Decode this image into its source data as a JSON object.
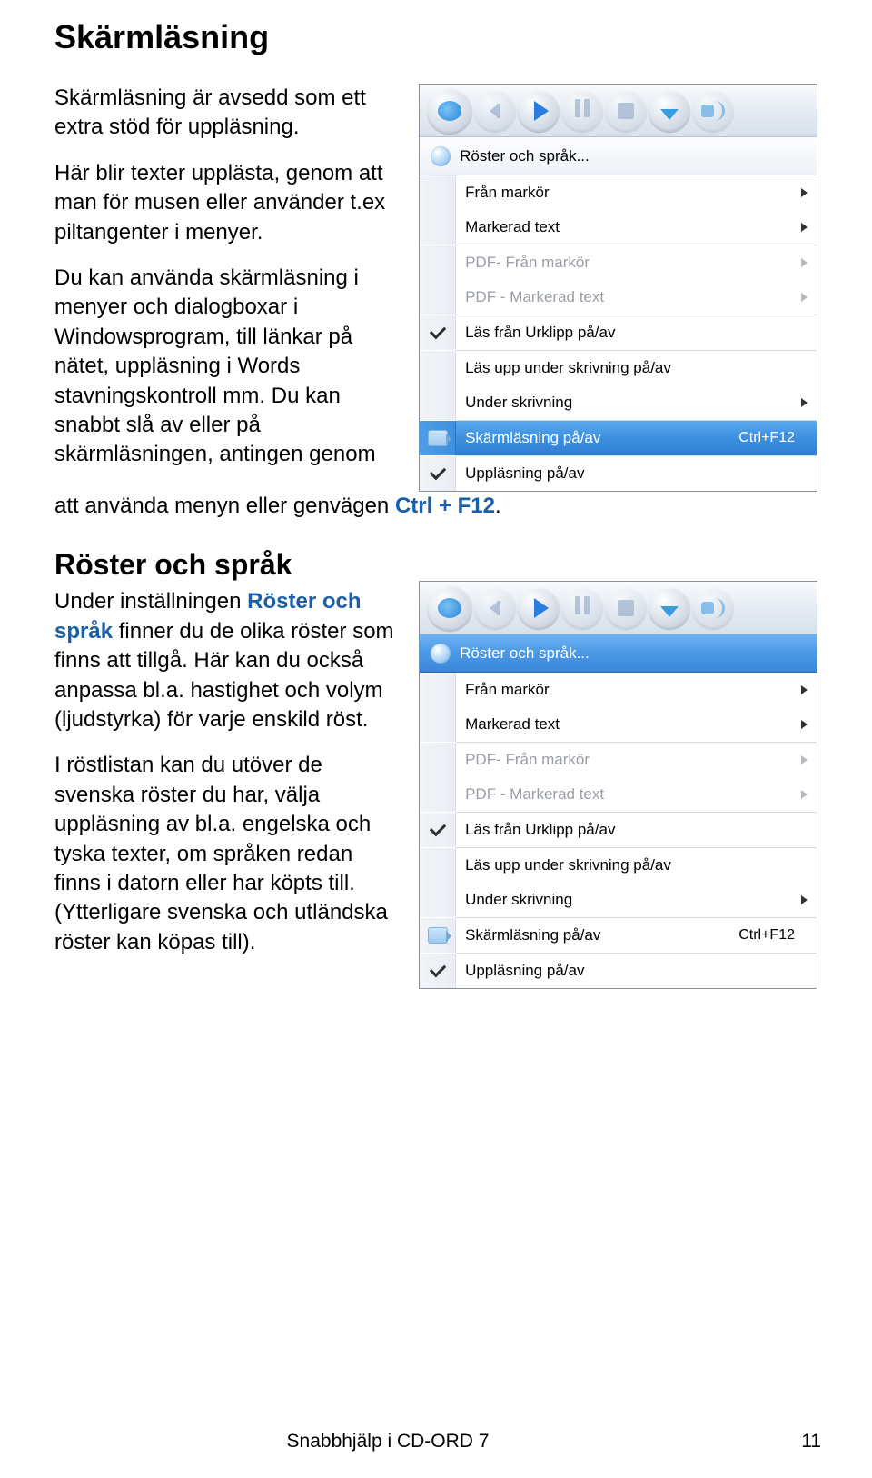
{
  "page_title": "Skärmläsning",
  "intro_p1": "Skärmläsning är avsedd som ett extra stöd för uppläsning.",
  "intro_p2": "Här blir texter upplästa, genom att man för musen eller använder t.ex piltangenter i menyer.",
  "intro_p3a": "Du kan använda skärmläsning i menyer och dialogboxar i Windowsprogram, till länkar på nätet, uppläsning i Words stavningskontroll mm. Du kan snabbt slå av eller på skärmläsningen, antingen genom ",
  "intro_p3b": "att använda menyn eller genvägen ",
  "shortcut_bold": "Ctrl + F12",
  "period": ".",
  "section2_title": "Röster och språk",
  "section2_p1_a": "Under inställningen ",
  "section2_p1_bold": "Röster och språk",
  "section2_p1_b": " finner du de olika röster som finns att tillgå. Här kan du också anpassa bl.a. hastighet och volym (ljudstyrka) för varje enskild röst.",
  "section2_p2": "I röstlistan kan du utöver de svenska röster du har, välja uppläsning av bl.a. engelska och tyska texter, om språken redan finns i datorn eller har köpts till. (Ytterligare svenska och utländska röster kan köpas till).",
  "menu": {
    "header": "Röster och språk...",
    "items": {
      "from_cursor": "Från markör",
      "marked_text": "Markerad text",
      "pdf_from_cursor": "PDF- Från markör",
      "pdf_marked_text": "PDF - Markerad text",
      "read_clipboard": "Läs från Urklipp på/av",
      "read_while_typing": "Läs upp under skrivning på/av",
      "while_typing": "Under skrivning",
      "screen_reading": "Skärmläsning på/av",
      "screen_reading_shortcut": "Ctrl+F12",
      "reading_toggle": "Uppläsning på/av"
    }
  },
  "footer": {
    "center": "Snabbhjälp i CD-ORD 7",
    "page": "11"
  }
}
